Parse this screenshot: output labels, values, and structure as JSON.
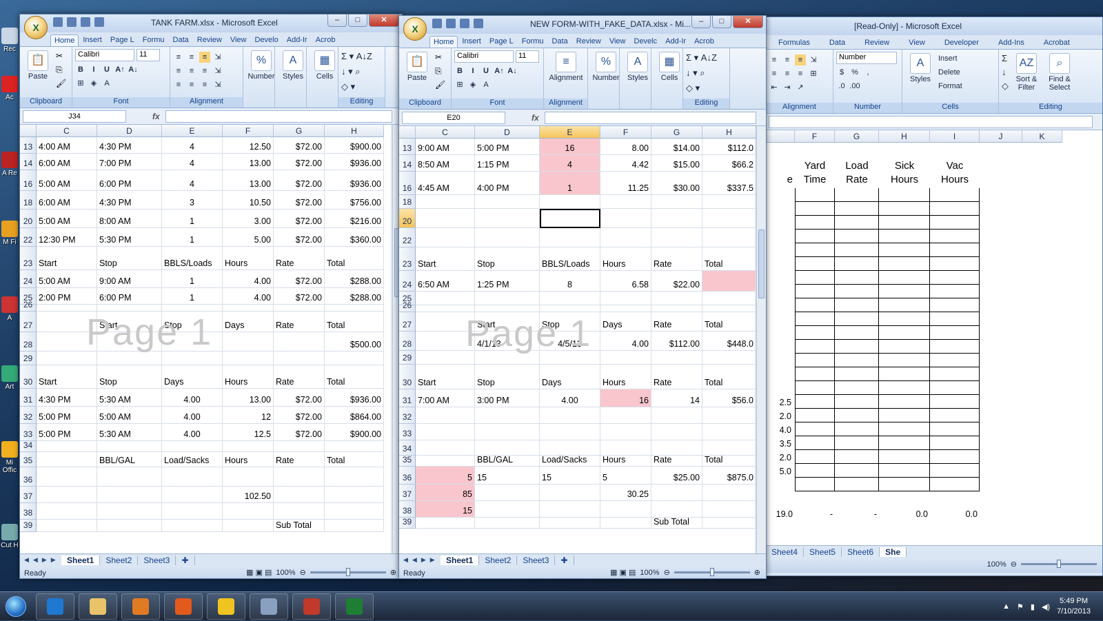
{
  "desktop": {
    "icons": [
      {
        "label": "Rec",
        "icon": "recycle-bin-icon"
      },
      {
        "label": "Ac",
        "icon": "acrobat-icon"
      },
      {
        "label": "A Re",
        "icon": "acrobat-reader-icon"
      },
      {
        "label": "M Fi",
        "icon": "folder-icon"
      },
      {
        "label": "A",
        "icon": "acrobat-icon"
      },
      {
        "label": "Art",
        "icon": "app-icon"
      },
      {
        "label": "Mi Offic",
        "icon": "office-icon"
      },
      {
        "label": "Cut H",
        "icon": "shortcut-icon"
      }
    ]
  },
  "windows": [
    {
      "id": "tankfarm",
      "title": "TANK FARM.xlsx - Microsoft Excel",
      "tabs": [
        "Home",
        "Insert",
        "Page L",
        "Formu",
        "Data",
        "Review",
        "View",
        "Develo",
        "Add-Ir",
        "Acrob"
      ],
      "active_tab": "Home",
      "ribbon": {
        "groups": [
          "Clipboard",
          "Font",
          "Alignment",
          "Editing"
        ],
        "font_name": "Calibri",
        "font_size": "11",
        "paste": "Paste",
        "number": "Number",
        "styles": "Styles",
        "cells": "Cells"
      },
      "name_box": "J34",
      "fx": "fx",
      "columns": [
        "C",
        "D",
        "E",
        "F",
        "G",
        "H"
      ],
      "watermark": "Page 1",
      "rows": [
        {
          "num": "13",
          "cells": [
            "4:00 AM",
            "4:30 PM",
            "4",
            "12.50",
            "$72.00",
            "$900.00"
          ]
        },
        {
          "num": "14",
          "cells": [
            "6:00 AM",
            "7:00 PM",
            "4",
            "13.00",
            "$72.00",
            "$936.00"
          ]
        },
        {
          "num": "16",
          "cells": [
            "5:00 AM",
            "6:00 PM",
            "4",
            "13.00",
            "$72.00",
            "$936.00"
          ]
        },
        {
          "num": "18",
          "cells": [
            "6:00 AM",
            "4:30 PM",
            "3",
            "10.50",
            "$72.00",
            "$756.00"
          ]
        },
        {
          "num": "20",
          "cells": [
            "5:00 AM",
            "8:00 AM",
            "1",
            "3.00",
            "$72.00",
            "$216.00"
          ]
        },
        {
          "num": "22",
          "cells": [
            "12:30 PM",
            "5:30 PM",
            "1",
            "5.00",
            "$72.00",
            "$360.00"
          ]
        },
        {
          "num": "23",
          "cells": [
            "Start",
            "Stop",
            "BBLS/Loads",
            "Hours",
            "Rate",
            "Total"
          ]
        },
        {
          "num": "24",
          "cells": [
            "5:00 AM",
            "9:00 AM",
            "1",
            "4.00",
            "$72.00",
            "$288.00"
          ]
        },
        {
          "num": "25",
          "cells": [
            "2:00 PM",
            "6:00 PM",
            "1",
            "4.00",
            "$72.00",
            "$288.00"
          ]
        },
        {
          "num": "26",
          "cells": [
            "",
            "",
            "",
            "",
            "",
            ""
          ]
        },
        {
          "num": "27",
          "cells": [
            "",
            "Start",
            "Stop",
            "Days",
            "Rate",
            "Total"
          ]
        },
        {
          "num": "28",
          "cells": [
            "",
            "",
            "",
            "",
            "",
            "$500.00"
          ]
        },
        {
          "num": "29",
          "cells": [
            "",
            "",
            "",
            "",
            "",
            ""
          ]
        },
        {
          "num": "30",
          "cells": [
            "Start",
            "Stop",
            "Days",
            "Hours",
            "Rate",
            "Total"
          ]
        },
        {
          "num": "31",
          "cells": [
            "4:30 PM",
            "5:30 AM",
            "4.00",
            "13.00",
            "$72.00",
            "$936.00"
          ]
        },
        {
          "num": "32",
          "cells": [
            "5:00 PM",
            "5:00 AM",
            "4.00",
            "12",
            "$72.00",
            "$864.00"
          ]
        },
        {
          "num": "33",
          "cells": [
            "5:00 PM",
            "5:30 AM",
            "4.00",
            "12.5",
            "$72.00",
            "$900.00"
          ]
        },
        {
          "num": "34",
          "cells": [
            "",
            "",
            "",
            "",
            "",
            ""
          ]
        },
        {
          "num": "35",
          "cells": [
            "",
            "BBL/GAL",
            "Load/Sacks",
            "Hours",
            "Rate",
            "Total"
          ]
        },
        {
          "num": "36",
          "cells": [
            "",
            "",
            "",
            "",
            "",
            ""
          ]
        },
        {
          "num": "37",
          "cells": [
            "",
            "",
            "",
            "102.50",
            "",
            ""
          ]
        },
        {
          "num": "38",
          "cells": [
            "",
            "",
            "",
            "",
            "",
            ""
          ]
        },
        {
          "num": "39",
          "cells": [
            "",
            "",
            "",
            "",
            "Sub Total",
            ""
          ]
        }
      ],
      "sheet_tabs": [
        "Sheet1",
        "Sheet2",
        "Sheet3"
      ],
      "active_sheet": "Sheet1",
      "status": "Ready",
      "zoom": "100%"
    },
    {
      "id": "newform",
      "title": "NEW FORM-WITH_FAKE_DATA.xlsx - Mi...",
      "tabs": [
        "Home",
        "Insert",
        "Page L",
        "Formu",
        "Data",
        "Review",
        "View",
        "Develc",
        "Add-Ir",
        "Acrob"
      ],
      "active_tab": "Home",
      "ribbon": {
        "groups": [
          "Clipboard",
          "Font",
          "Alignment",
          "Number",
          "Styles",
          "Cells",
          "Editing"
        ],
        "font_name": "Calibri",
        "font_size": "11",
        "paste": "Paste",
        "alignment": "Alignment",
        "number": "Number",
        "styles": "Styles",
        "cells": "Cells"
      },
      "name_box": "E20",
      "fx": "fx",
      "columns": [
        "C",
        "D",
        "E",
        "F",
        "G",
        "H"
      ],
      "selected_column": "E",
      "selected_row": "20",
      "watermark": "Page 1",
      "rows": [
        {
          "num": "13",
          "cells": [
            "9:00 AM",
            "5:00 PM",
            "16",
            "8.00",
            "$14.00",
            "$112.0"
          ]
        },
        {
          "num": "14",
          "cells": [
            "8:50 AM",
            "1:15 PM",
            "4",
            "4.42",
            "$15.00",
            "$66.2"
          ]
        },
        {
          "num": "16",
          "cells": [
            "4:45 AM",
            "4:00 PM",
            "1",
            "11.25",
            "$30.00",
            "$337.5"
          ]
        },
        {
          "num": "18",
          "cells": [
            "",
            "",
            "",
            "",
            "",
            ""
          ]
        },
        {
          "num": "20",
          "cells": [
            "",
            "",
            "",
            "",
            "",
            ""
          ]
        },
        {
          "num": "22",
          "cells": [
            "",
            "",
            "",
            "",
            "",
            ""
          ]
        },
        {
          "num": "23",
          "cells": [
            "Start",
            "Stop",
            "BBLS/Loads",
            "Hours",
            "Rate",
            "Total"
          ]
        },
        {
          "num": "24",
          "cells": [
            "6:50 AM",
            "1:25 PM",
            "8",
            "6.58",
            "$22.00",
            ""
          ]
        },
        {
          "num": "25",
          "cells": [
            "",
            "",
            "",
            "",
            "",
            ""
          ]
        },
        {
          "num": "26",
          "cells": [
            "",
            "",
            "",
            "",
            "",
            ""
          ]
        },
        {
          "num": "27",
          "cells": [
            "",
            "Start",
            "Stop",
            "Days",
            "Rate",
            "Total"
          ]
        },
        {
          "num": "28",
          "cells": [
            "",
            "4/1/13",
            "4/5/13",
            "4.00",
            "$112.00",
            "$448.0"
          ]
        },
        {
          "num": "29",
          "cells": [
            "",
            "",
            "",
            "",
            "",
            ""
          ]
        },
        {
          "num": "30",
          "cells": [
            "Start",
            "Stop",
            "Days",
            "Hours",
            "Rate",
            "Total"
          ]
        },
        {
          "num": "31",
          "cells": [
            "7:00 AM",
            "3:00 PM",
            "4.00",
            "16",
            "14",
            "$56.0"
          ]
        },
        {
          "num": "32",
          "cells": [
            "",
            "",
            "",
            "",
            "",
            ""
          ]
        },
        {
          "num": "33",
          "cells": [
            "",
            "",
            "",
            "",
            "",
            ""
          ]
        },
        {
          "num": "34",
          "cells": [
            "",
            "",
            "",
            "",
            "",
            ""
          ]
        },
        {
          "num": "35",
          "cells": [
            "",
            "BBL/GAL",
            "Load/Sacks",
            "Hours",
            "Rate",
            "Total"
          ]
        },
        {
          "num": "36",
          "cells": [
            "5",
            "15",
            "15",
            "5",
            "$25.00",
            "$875.0"
          ]
        },
        {
          "num": "37",
          "cells": [
            "85",
            "",
            "",
            "30.25",
            "",
            ""
          ]
        },
        {
          "num": "38",
          "cells": [
            "15",
            "",
            "",
            "",
            "",
            ""
          ]
        },
        {
          "num": "39",
          "cells": [
            "",
            "",
            "",
            "",
            "Sub Total",
            ""
          ]
        }
      ],
      "sheet_tabs": [
        "Sheet1",
        "Sheet2",
        "Sheet3"
      ],
      "active_sheet": "Sheet1",
      "status": "Ready",
      "zoom": "100%"
    },
    {
      "id": "readonly",
      "title": "[Read-Only] - Microsoft Excel",
      "tabs": [
        "Formulas",
        "Data",
        "Review",
        "View",
        "Developer",
        "Add-Ins",
        "Acrobat"
      ],
      "ribbon": {
        "number_format": "Number",
        "insert": "Insert",
        "delete": "Delete",
        "format": "Format",
        "styles": "Styles",
        "sort": "Sort & Filter",
        "find": "Find & Select",
        "groups": [
          "Alignment",
          "Number",
          "Cells",
          "Editing"
        ]
      },
      "columns": [
        "F",
        "G",
        "H",
        "I",
        "J",
        "K"
      ],
      "header1": [
        "Yard",
        "Load",
        "Sick",
        "Vac"
      ],
      "header2": [
        "e",
        "Time",
        "Rate",
        "Hours",
        "Hours"
      ],
      "left_values": [
        "2.5",
        "2.0",
        "4.0",
        "3.5",
        "2.0",
        "5.0"
      ],
      "totals": [
        "19.0",
        "-",
        "-",
        "0.0",
        "0.0"
      ],
      "sheet_tabs": [
        "Sheet4",
        "Sheet5",
        "Sheet6",
        "She"
      ],
      "zoom": "100%"
    }
  ],
  "taskbar": {
    "apps": [
      "internet-explorer-icon",
      "explorer-icon",
      "media-player-icon",
      "firefox-icon",
      "outlook-icon",
      "calculator-icon",
      "presentation-icon",
      "excel-icon"
    ],
    "time": "5:49 PM",
    "date": "7/10/2013"
  }
}
